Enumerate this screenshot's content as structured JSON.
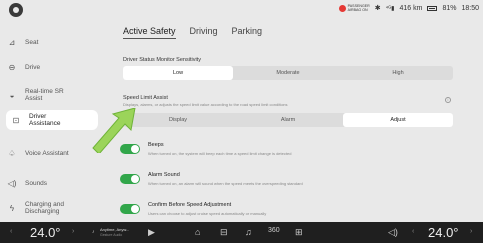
{
  "status": {
    "airbag_line1": "PASSENGER",
    "airbag_line2": "AIRBAG ON",
    "range": "416 km",
    "battery": "81%",
    "time": "18:50",
    "bluetooth_icon": "bluetooth-icon",
    "signal_icon": "signal-icon"
  },
  "sidebar": {
    "items": [
      {
        "label": "Seat",
        "icon": "seat-icon"
      },
      {
        "label": "Drive",
        "icon": "steering-icon"
      },
      {
        "label": "Real-time SR Assist",
        "icon": "sr-icon"
      },
      {
        "label": "Driver Assistance",
        "icon": "driver-assist-icon"
      },
      {
        "label": "Voice Assistant",
        "icon": "voice-icon"
      },
      {
        "label": "Sounds",
        "icon": "speaker-icon"
      },
      {
        "label": "Charging and Discharging",
        "icon": "charging-icon"
      }
    ]
  },
  "tabs": [
    "Active Safety",
    "Driving",
    "Parking"
  ],
  "monitor": {
    "title": "Driver Status Monitor Sensitivity",
    "options": [
      "Low",
      "Moderate",
      "High"
    ],
    "selected": "Low"
  },
  "speed_limit": {
    "title": "Speed Limit Assist",
    "desc": "Displays, alarms, or adjusts the speed limit value according to the road speed limit conditions",
    "options": [
      "Display",
      "Alarm",
      "Adjust"
    ],
    "selected": "Adjust"
  },
  "toggles": [
    {
      "title": "Beeps",
      "desc": "When turned on, the system will beep each time a speed limit change is detected",
      "on": true
    },
    {
      "title": "Alarm Sound",
      "desc": "When turned on, an alarm will sound when the speed meets the overspeeding standard",
      "on": true
    },
    {
      "title": "Confirm Before Speed Adjustment",
      "desc": "Users can choose to adjust cruise speed automatically or manually",
      "on": true
    }
  ],
  "dock": {
    "temp_left": "24.0°",
    "temp_right": "24.0°",
    "music_title": "Anytime, Anyw...",
    "music_sub": "Gesture Audio",
    "play_icon": "play-icon",
    "home_icon": "home-icon",
    "car_icon": "car-icon",
    "music_icon": "music-icon",
    "camera_icon": "360-camera-icon",
    "apps_icon": "apps-grid-icon",
    "volume_icon": "volume-icon",
    "accent": "#31a64a"
  }
}
